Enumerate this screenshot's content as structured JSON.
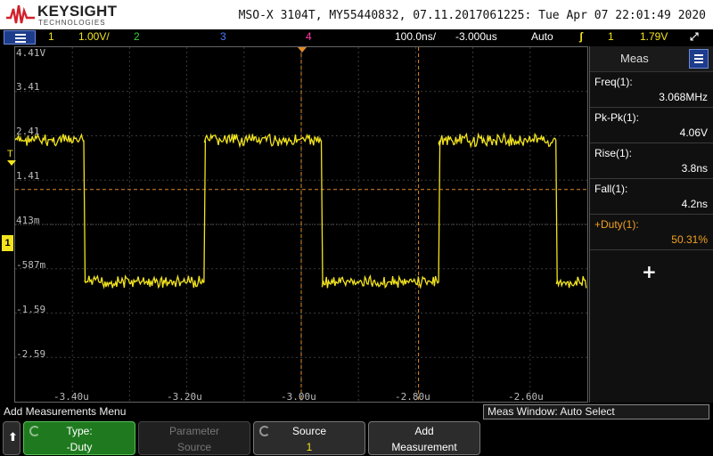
{
  "header": {
    "brand": "KEYSIGHT",
    "brand_sub": "TECHNOLOGIES",
    "scope_info": "MSO-X 3104T, MY55440832, 07.11.2017061225: Tue Apr 07 22:01:49 2020"
  },
  "statusbar": {
    "ch1_label": "1",
    "ch1_scale": "1.00V/",
    "ch2_label": "2",
    "ch3_label": "3",
    "ch4_label": "4",
    "timebase": "100.0ns/",
    "delay": "-3.000us",
    "trigger_mode": "Auto",
    "trigger_source": "1",
    "trigger_level": "1.79V"
  },
  "screen": {
    "y_labels": [
      "4.41V",
      "3.41",
      "2.41",
      "1.41",
      "413m",
      "-587m",
      "-1.59",
      "-2.59"
    ],
    "x_labels": [
      "-3.40u",
      "-3.20u",
      "-3.00u",
      "-2.80u",
      "-2.60u"
    ],
    "trigger_marker": "T",
    "channel_marker": "1"
  },
  "measurements": {
    "title": "Meas",
    "items": [
      {
        "label": "Freq(1):",
        "value": "3.068MHz"
      },
      {
        "label": "Pk-Pk(1):",
        "value": "4.06V"
      },
      {
        "label": "Rise(1):",
        "value": "3.8ns"
      },
      {
        "label": "Fall(1):",
        "value": "4.2ns"
      },
      {
        "label": "+Duty(1):",
        "value": "50.31%"
      }
    ],
    "add_symbol": "+"
  },
  "softkeys": {
    "menu_title": "Add Measurements Menu",
    "meas_window": "Meas Window: Auto Select",
    "type_label": "Type:",
    "type_value": "-Duty",
    "param_label": "Parameter",
    "param_value": "Source",
    "source_label": "Source",
    "source_value": "1",
    "add_label": "Add",
    "add_value": "Measurement"
  },
  "colors": {
    "ch1": "#f2e41e",
    "ch2": "#3ccc3c",
    "ch3": "#4a7aff",
    "ch4": "#ff3ca8",
    "cursor": "#e08a2a",
    "accent_orange": "#f2a01e"
  },
  "chart_data": {
    "type": "line",
    "series": [
      {
        "name": "1",
        "waveform": "square",
        "high_v": 2.9,
        "low_v": -0.3,
        "edges_us": [
          -3.38,
          -3.17,
          -2.965,
          -2.76,
          -2.555
        ]
      }
    ],
    "x_range_us": [
      -3.5,
      -2.5
    ],
    "y_range_v": [
      -3.0,
      5.0
    ],
    "cursor_x_us": [
      -3.0,
      -2.795
    ],
    "cursor_y_v": 1.79
  }
}
